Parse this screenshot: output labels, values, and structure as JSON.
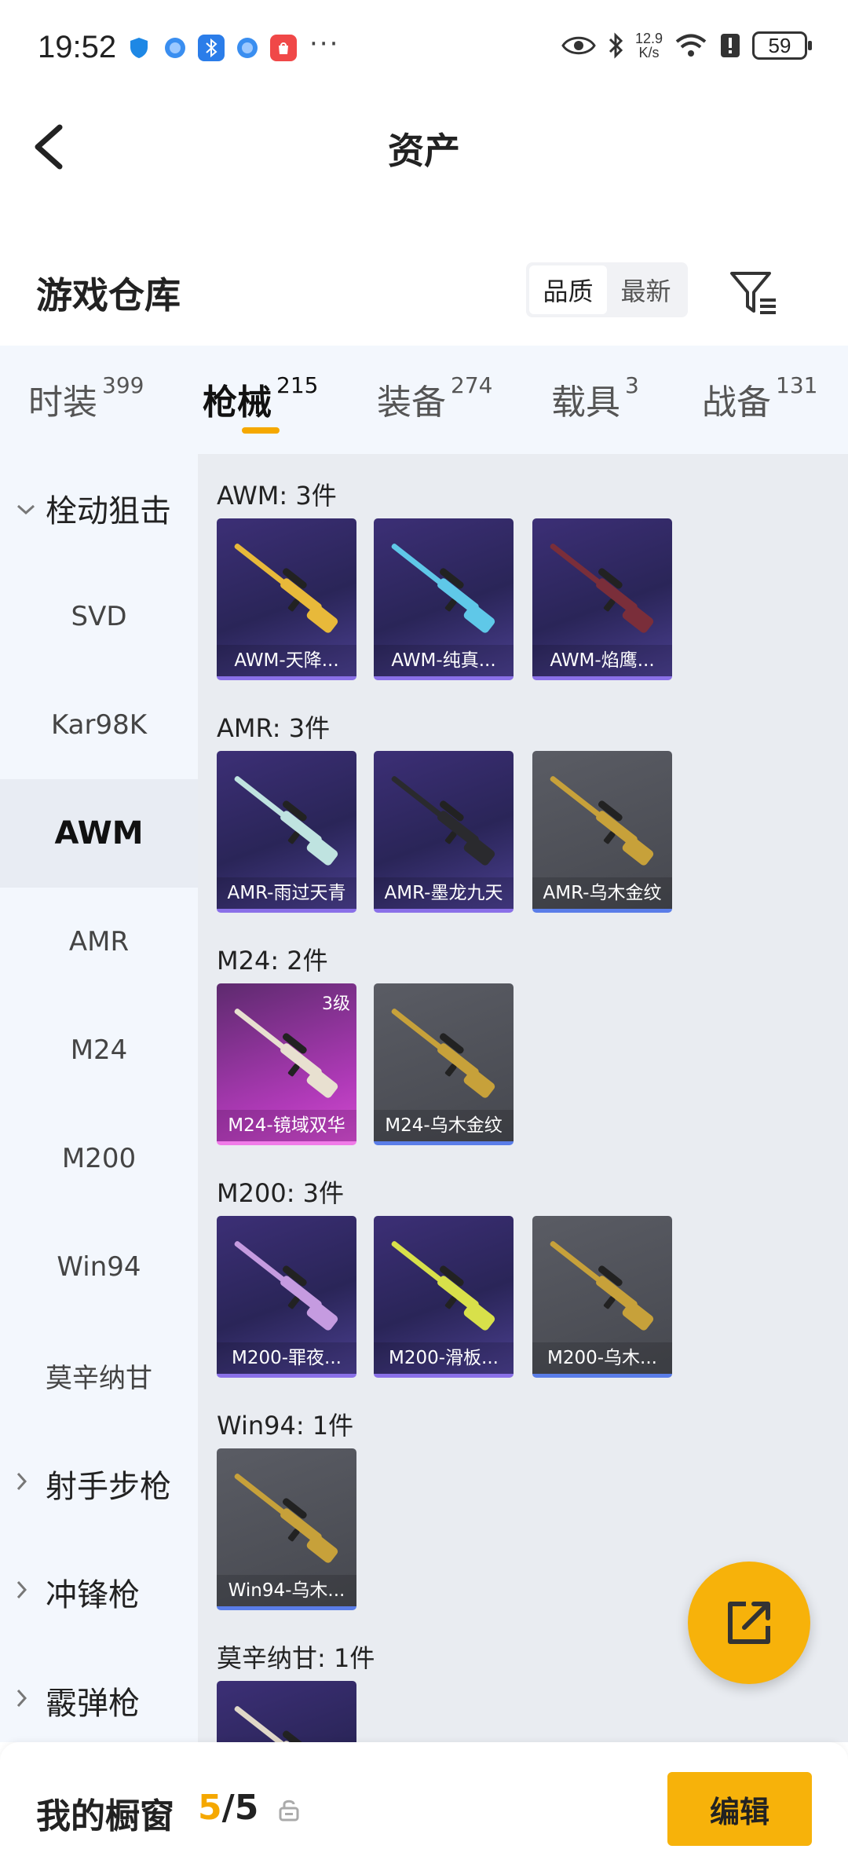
{
  "status_bar": {
    "time": "19:52",
    "net_speed_value": "12.9",
    "net_speed_unit": "K/s",
    "battery": "59",
    "more": "···"
  },
  "header": {
    "title": "资产"
  },
  "warehouse": {
    "title": "游戏仓库",
    "sort_options": [
      "品质",
      "最新"
    ],
    "sort_selected": "品质"
  },
  "tabs": [
    {
      "label": "时装",
      "count": "399"
    },
    {
      "label": "枪械",
      "count": "215"
    },
    {
      "label": "装备",
      "count": "274"
    },
    {
      "label": "载具",
      "count": "3"
    },
    {
      "label": "战备",
      "count": "131"
    }
  ],
  "sidebar": {
    "open_group": "栓动狙击",
    "items": [
      "SVD",
      "Kar98K",
      "AWM",
      "AMR",
      "M24",
      "M200",
      "Win94",
      "莫辛纳甘"
    ],
    "selected": "AWM",
    "collapsed_groups": [
      "射手步枪",
      "冲锋枪",
      "霰弹枪"
    ]
  },
  "groups": [
    {
      "label": "AWM: 3件",
      "items": [
        {
          "name": "AWM-天降...",
          "rarity": "purple",
          "color": "#e8b93a"
        },
        {
          "name": "AWM-纯真...",
          "rarity": "purple",
          "color": "#5fc8e8"
        },
        {
          "name": "AWM-焰鹰...",
          "rarity": "purple",
          "color": "#7a2e3a"
        }
      ]
    },
    {
      "label": "AMR: 3件",
      "items": [
        {
          "name": "AMR-雨过天青",
          "rarity": "purple",
          "color": "#bfe3e0"
        },
        {
          "name": "AMR-墨龙九天",
          "rarity": "purple",
          "color": "#2a2a2e"
        },
        {
          "name": "AMR-乌木金纹",
          "rarity": "gray",
          "color": "#c7a13a"
        }
      ]
    },
    {
      "label": "M24: 2件",
      "items": [
        {
          "name": "M24-镜域双华",
          "rarity": "pink",
          "color": "#e8e0d0",
          "level": "3级"
        },
        {
          "name": "M24-乌木金纹",
          "rarity": "gray",
          "color": "#c7a13a"
        }
      ]
    },
    {
      "label": "M200: 3件",
      "items": [
        {
          "name": "M200-罪夜...",
          "rarity": "purple",
          "color": "#c59be0"
        },
        {
          "name": "M200-滑板...",
          "rarity": "purple",
          "color": "#d8e04a"
        },
        {
          "name": "M200-乌木...",
          "rarity": "gray",
          "color": "#c7a13a"
        }
      ]
    },
    {
      "label": "Win94: 1件",
      "items": [
        {
          "name": "Win94-乌木...",
          "rarity": "gray",
          "color": "#c7a13a"
        }
      ]
    },
    {
      "label": "莫辛纳甘: 1件",
      "items": [
        {
          "name": "",
          "rarity": "purple",
          "color": "#e0d8c8"
        }
      ]
    }
  ],
  "bottom_bar": {
    "label": "我的橱窗",
    "current": "5",
    "total": "/5",
    "edit_label": "编辑"
  }
}
